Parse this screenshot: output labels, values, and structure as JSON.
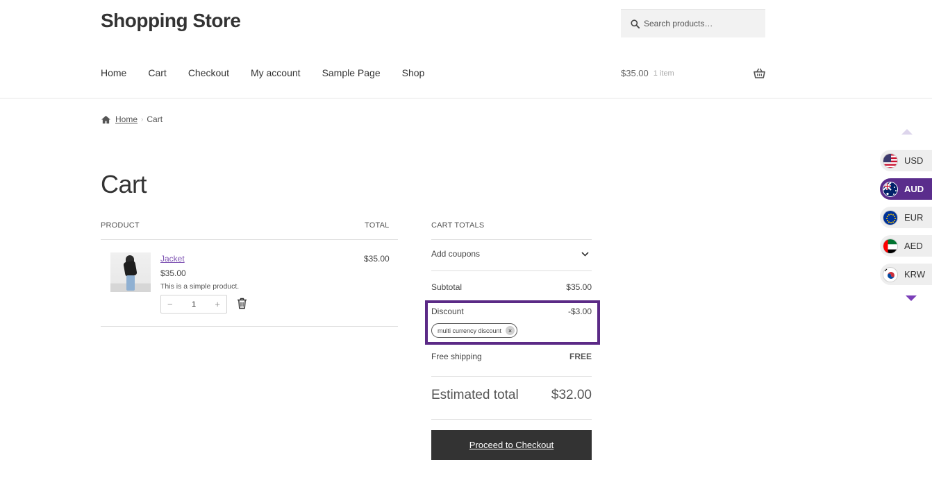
{
  "site": {
    "title": "Shopping Store"
  },
  "search": {
    "placeholder": "Search products…"
  },
  "nav": {
    "items": [
      "Home",
      "Cart",
      "Checkout",
      "My account",
      "Sample Page",
      "Shop"
    ]
  },
  "mini_cart": {
    "amount": "$35.00",
    "count": "1 item"
  },
  "breadcrumb": {
    "home": "Home",
    "current": "Cart"
  },
  "page": {
    "title": "Cart"
  },
  "cart": {
    "col_product": "PRODUCT",
    "col_total": "TOTAL",
    "item": {
      "name": "Jacket",
      "price": "$35.00",
      "description": "This is a simple product.",
      "quantity": "1",
      "minus": "−",
      "plus": "+",
      "total": "$35.00"
    }
  },
  "totals": {
    "heading": "CART TOTALS",
    "coupons_label": "Add coupons",
    "subtotal_label": "Subtotal",
    "subtotal_value": "$35.00",
    "discount_label": "Discount",
    "discount_value": "-$3.00",
    "coupon_chip": "multi currency discount",
    "coupon_remove": "×",
    "shipping_label": "Free shipping",
    "shipping_value": "FREE",
    "estimated_label": "Estimated total",
    "estimated_value": "$32.00",
    "checkout_button": "Proceed to Checkout"
  },
  "currency_switcher": {
    "selected": "AUD",
    "items": [
      {
        "code": "USD",
        "flag": "us-flag-icon"
      },
      {
        "code": "AUD",
        "flag": "au-flag-icon"
      },
      {
        "code": "EUR",
        "flag": "eu-flag-icon"
      },
      {
        "code": "AED",
        "flag": "ae-flag-icon"
      },
      {
        "code": "KRW",
        "flag": "kr-flag-icon"
      }
    ]
  },
  "colors": {
    "accent": "#7f54b3",
    "highlight_border": "#5b2a86",
    "button": "#333333",
    "active_currency": "#5a2d8c"
  }
}
